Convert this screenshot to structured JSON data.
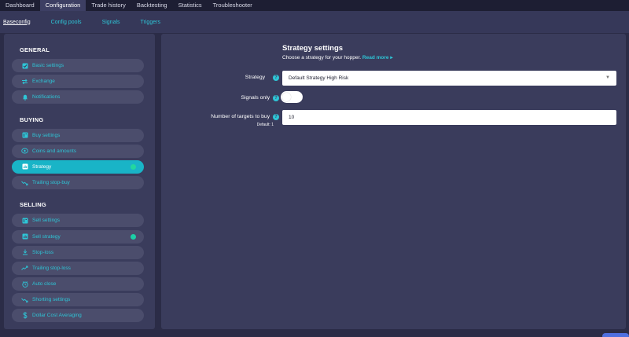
{
  "topnav": {
    "tabs": [
      {
        "label": "Dashboard"
      },
      {
        "label": "Configuration"
      },
      {
        "label": "Trade history"
      },
      {
        "label": "Backtesting"
      },
      {
        "label": "Statistics"
      },
      {
        "label": "Troubleshooter"
      }
    ],
    "active": "Configuration"
  },
  "subnav": {
    "tabs": [
      {
        "label": "Baseconfig"
      },
      {
        "label": "Config pools"
      },
      {
        "label": "Signals"
      },
      {
        "label": "Triggers"
      }
    ],
    "active": "Baseconfig"
  },
  "sidebar": {
    "general": {
      "heading": "GENERAL",
      "items": [
        {
          "label": "Basic settings",
          "icon": "checkbox-icon"
        },
        {
          "label": "Exchange",
          "icon": "swap-icon"
        },
        {
          "label": "Notifications",
          "icon": "bell-icon"
        }
      ]
    },
    "buying": {
      "heading": "BUYING",
      "items": [
        {
          "label": "Buy settings",
          "icon": "sliders-icon"
        },
        {
          "label": "Coins and amounts",
          "icon": "coins-icon"
        },
        {
          "label": "Strategy",
          "icon": "bar-chart-icon"
        },
        {
          "label": "Trailing stop-buy",
          "icon": "trend-down-icon"
        }
      ]
    },
    "selling": {
      "heading": "SELLING",
      "items": [
        {
          "label": "Sell settings",
          "icon": "sliders-icon"
        },
        {
          "label": "Sell strategy",
          "icon": "bar-chart-icon"
        },
        {
          "label": "Stop-loss",
          "icon": "stop-loss-icon"
        },
        {
          "label": "Trailing stop-loss",
          "icon": "trend-up-icon"
        },
        {
          "label": "Auto close",
          "icon": "clock-icon"
        },
        {
          "label": "Shorting settings",
          "icon": "trend-down-icon"
        },
        {
          "label": "Dollar Cost Averaging",
          "icon": "dollar-icon"
        }
      ]
    },
    "accent": "#19b4c7",
    "status_dot": "#1ccfa6"
  },
  "main": {
    "title": "Strategy settings",
    "subtitle": "Choose a strategy for your hopper.",
    "read_more": "Read more",
    "read_more_arrow": "▸",
    "strategy_label": "Strategy",
    "strategy_value": "Default Strategy High Risk",
    "signals_label": "Signals only",
    "signals_enabled": false,
    "targets_label": "Number of targets to buy",
    "targets_value": "10",
    "targets_default": "Default: 1",
    "help_glyph": "?"
  }
}
